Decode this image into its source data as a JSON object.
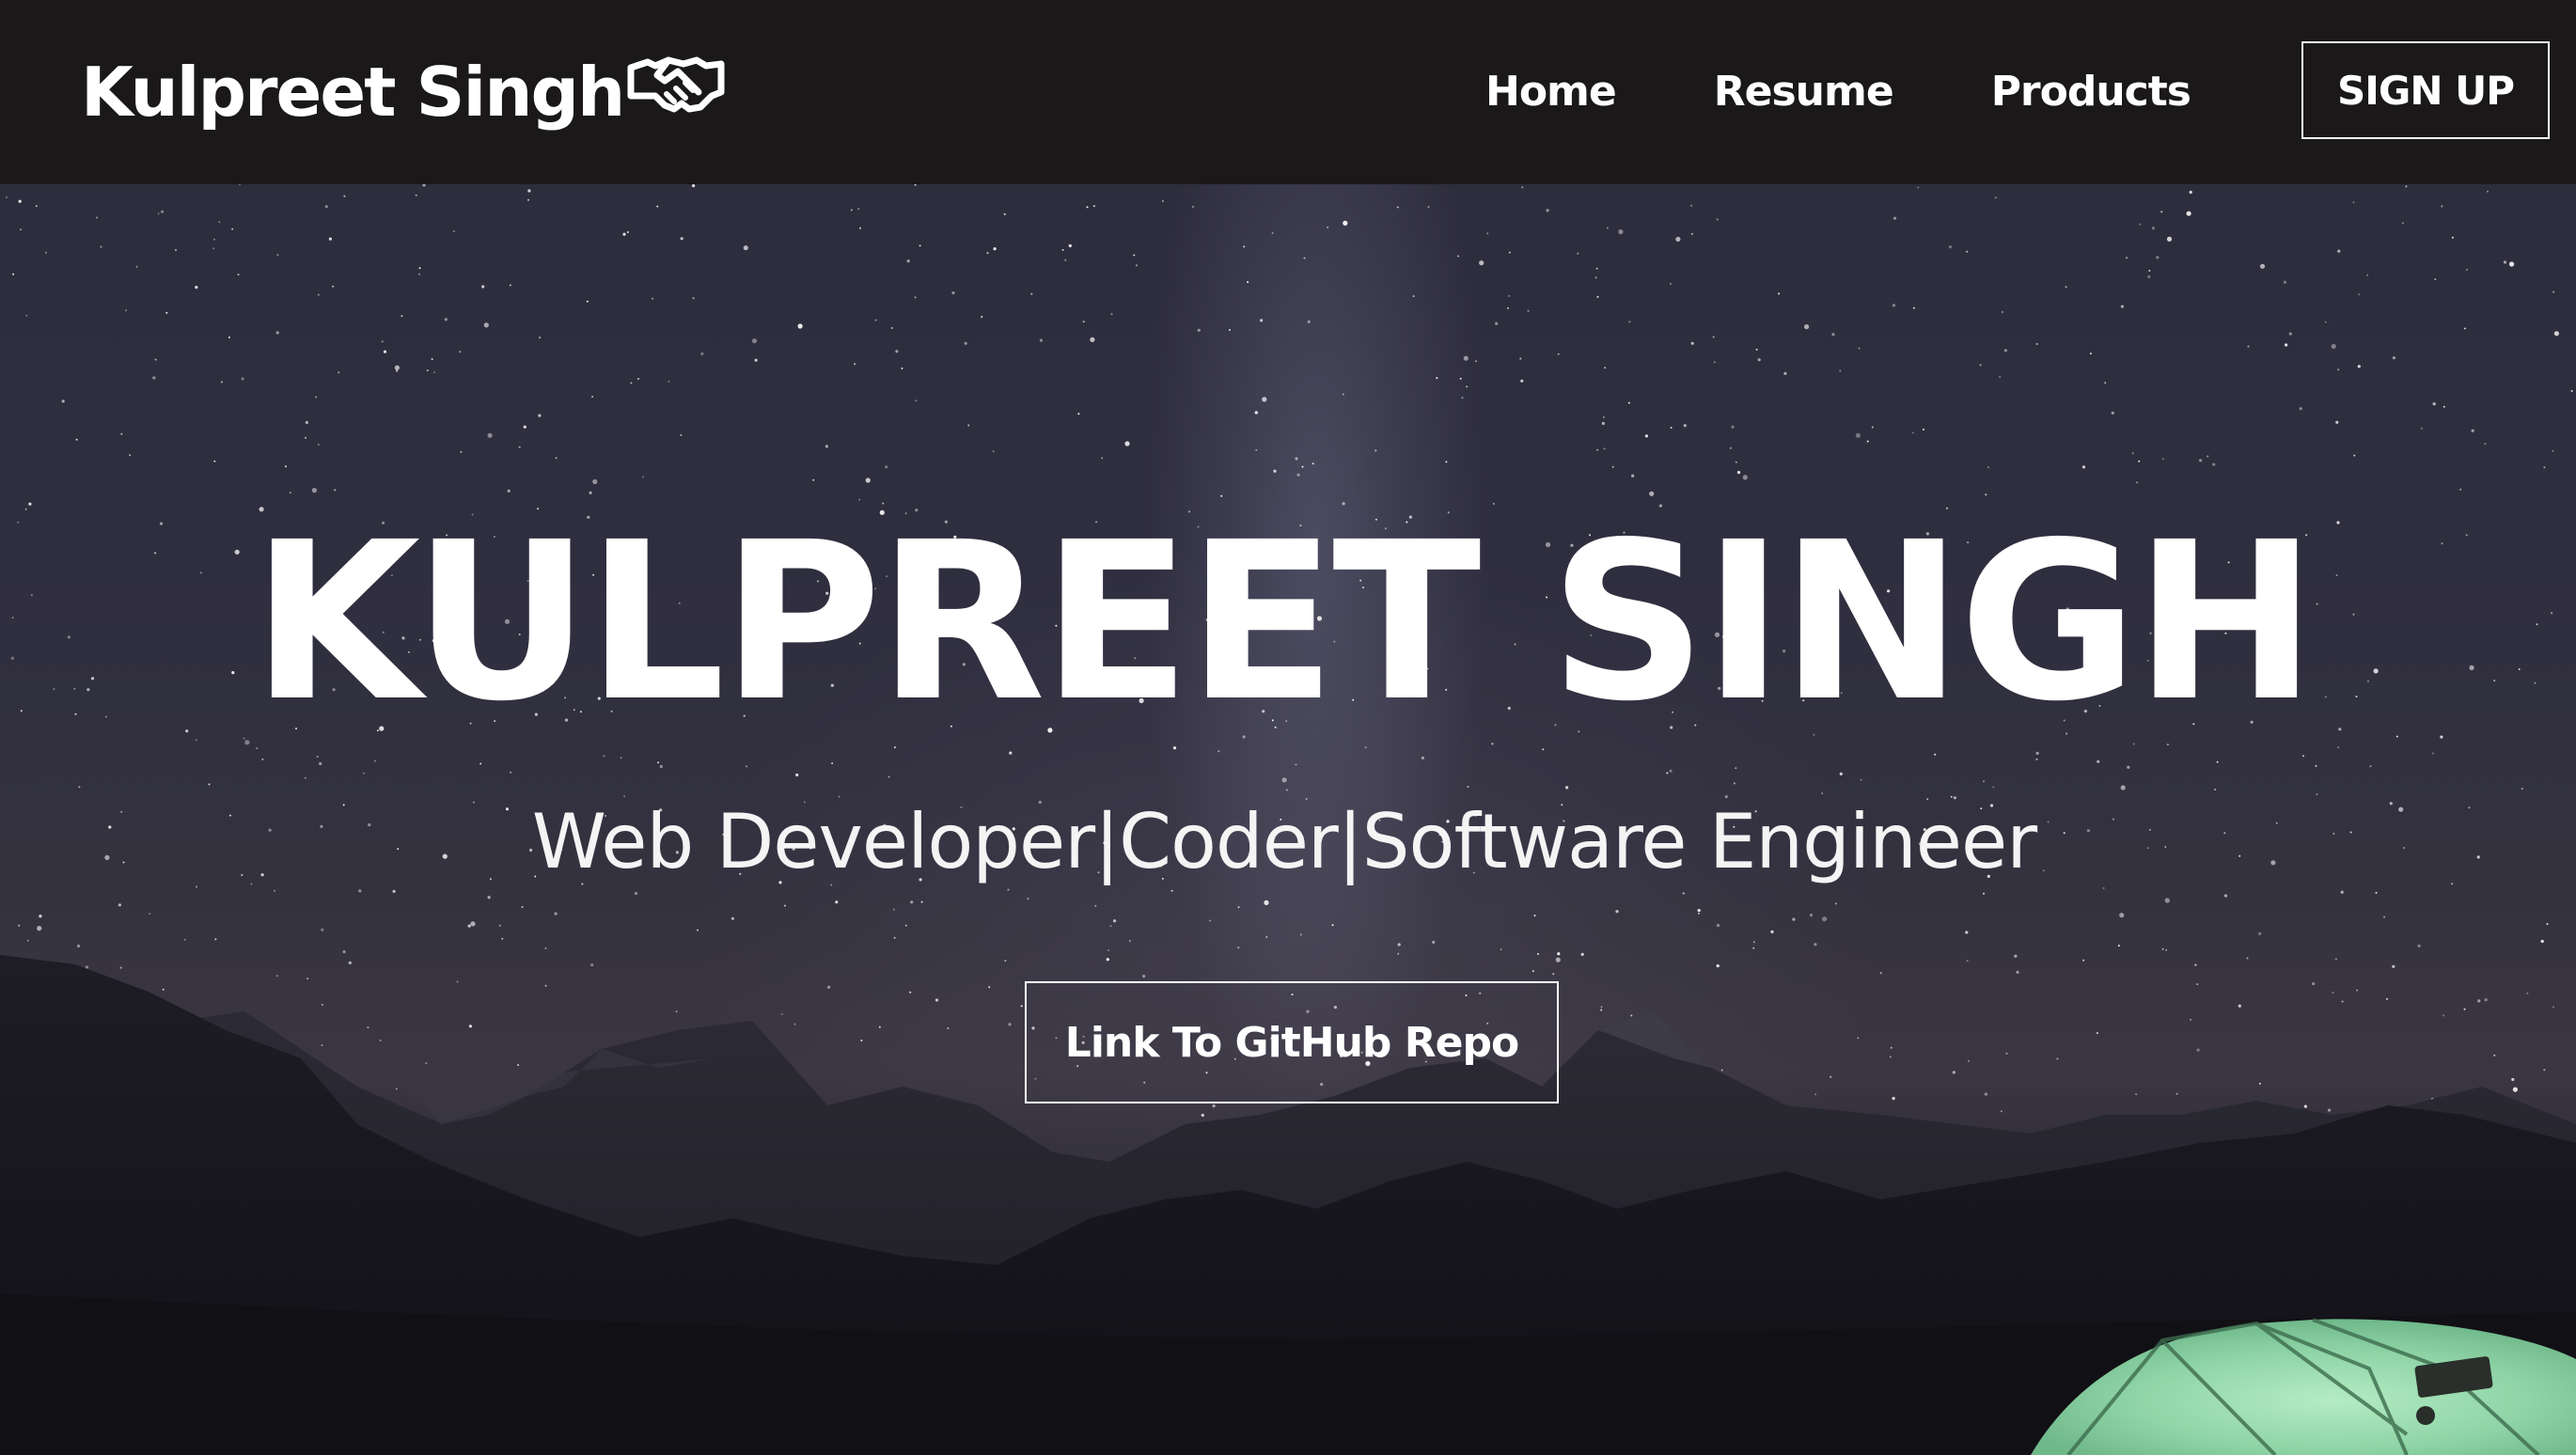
{
  "navbar": {
    "brand": "Kulpreet Singh",
    "brand_icon": "handshake-icon",
    "links": [
      {
        "label": "Home"
      },
      {
        "label": "Resume"
      },
      {
        "label": "Products"
      }
    ],
    "signup_label": "SIGN UP"
  },
  "hero": {
    "title": "KULPREET SINGH",
    "subtitle": "Web Developer|Coder|Software Engineer",
    "button_label": "Link To GitHub Repo",
    "background": "night-sky-mountains-tent-image"
  },
  "colors": {
    "navbar_bg": "#1a1819",
    "text": "#ffffff",
    "sky": "#2f2e3f",
    "tent": "#8fd4a6"
  }
}
